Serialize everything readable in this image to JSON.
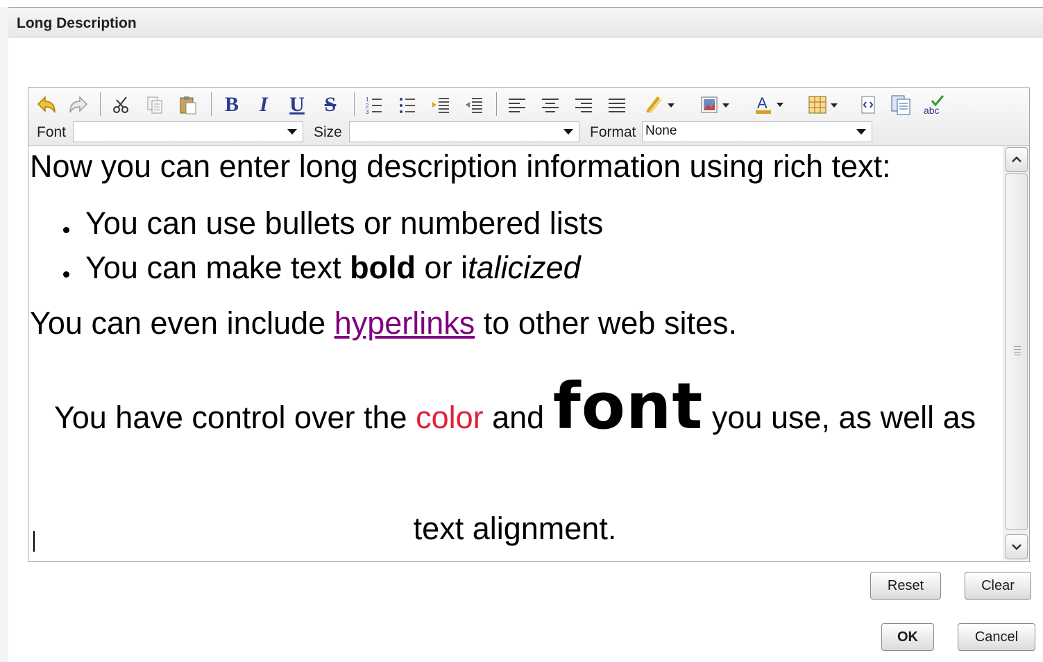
{
  "dialog": {
    "title": "Long Description"
  },
  "toolbar": {
    "font_label": "Font",
    "font_value": "",
    "size_label": "Size",
    "size_value": "",
    "format_label": "Format",
    "format_value": "None",
    "icons": [
      "undo-icon",
      "redo-icon",
      "cut-icon",
      "copy-icon",
      "paste-icon",
      "bold-icon",
      "italic-icon",
      "underline-icon",
      "strikethrough-icon",
      "numbered-list-icon",
      "bulleted-list-icon",
      "indent-icon",
      "outdent-icon",
      "align-left-icon",
      "align-center-icon",
      "align-right-icon",
      "justify-icon",
      "link-icon",
      "image-icon",
      "text-color-icon",
      "table-icon",
      "source-icon",
      "paste-word-icon",
      "spellcheck-icon"
    ]
  },
  "content": {
    "line1": "Now you can enter long description information using rich text:",
    "bullet1": "You can use bullets or numbered lists",
    "bullet2_prefix": "You can make text ",
    "bullet2_bold": "bold",
    "bullet2_mid": " or i",
    "bullet2_italic": "talicized",
    "links_prefix": "You can even include ",
    "link_text": "hyperlinks",
    "links_suffix": " to other web sites.",
    "color_prefix": "You have control over the ",
    "color_word": "color",
    "color_mid": " and ",
    "font_word": "font",
    "color_suffix": " you use, as well as",
    "align_line": "text alignment.",
    "link_color": "#800080",
    "color_word_color": "#e0213a"
  },
  "buttons": {
    "reset": "Reset",
    "clear": "Clear",
    "ok": "OK",
    "cancel": "Cancel"
  }
}
